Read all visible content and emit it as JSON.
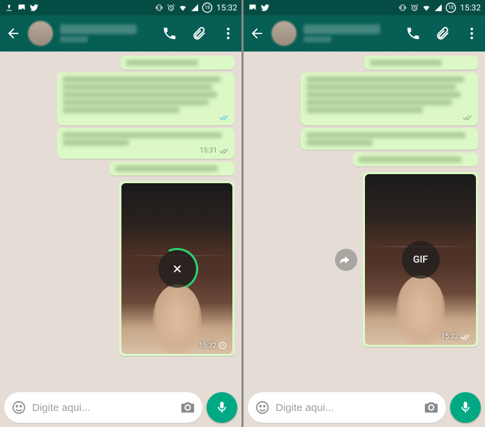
{
  "status": {
    "time": "15:32",
    "battery_label": "18"
  },
  "contact": {
    "name": "████████",
    "status": "online"
  },
  "input": {
    "placeholder": "Digite aqui..."
  },
  "messages": {
    "m1_time": "15:31",
    "media_time": "15:32",
    "gif_label": "GIF"
  },
  "colors": {
    "primary": "#075e54",
    "accent": "#00a884",
    "bubble": "#dcf8c6"
  }
}
